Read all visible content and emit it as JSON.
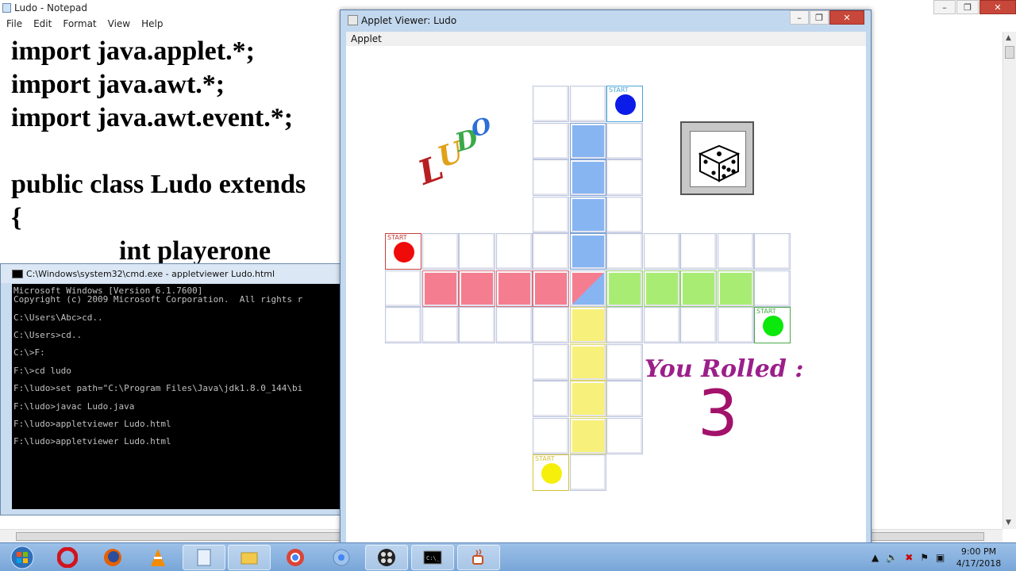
{
  "notepad": {
    "title": "Ludo - Notepad",
    "menu": [
      "File",
      "Edit",
      "Format",
      "View",
      "Help"
    ],
    "code": "import java.applet.*;\nimport java.awt.*;\nimport java.awt.event.*;\n\npublic class Ludo extends                                                                                                                                    MotionLis\n{\n                int playerone"
  },
  "cmd": {
    "title": "C:\\Windows\\system32\\cmd.exe - appletviewer  Ludo.html",
    "lines": "Microsoft Windows [Version 6.1.7600]\nCopyright (c) 2009 Microsoft Corporation.  All rights r\n\nC:\\Users\\Abc>cd..\n\nC:\\Users>cd..\n\nC:\\>F:\n\nF:\\>cd ludo\n\nF:\\ludo>set path=\"C:\\Program Files\\Java\\jdk1.8.0_144\\bi\n\nF:\\ludo>javac Ludo.java\n\nF:\\ludo>appletviewer Ludo.html\n\nF:\\ludo>appletviewer Ludo.html"
  },
  "applet": {
    "title": "Applet Viewer: Ludo",
    "menu": "Applet",
    "logo": [
      "L",
      "U",
      "D",
      "O"
    ],
    "start_label": "START",
    "rolled_label": "You Rolled :",
    "rolled_value": "3",
    "dice_value": 5
  },
  "taskbar": {
    "apps": [
      "start",
      "opera",
      "firefox",
      "vlc",
      "notepad",
      "explorer",
      "chrome",
      "chrome-canary",
      "media",
      "cmd",
      "java"
    ],
    "active": [
      "notepad",
      "explorer",
      "media",
      "cmd",
      "java"
    ]
  },
  "clock": {
    "time": "9:00 PM",
    "date": "4/17/2018"
  }
}
